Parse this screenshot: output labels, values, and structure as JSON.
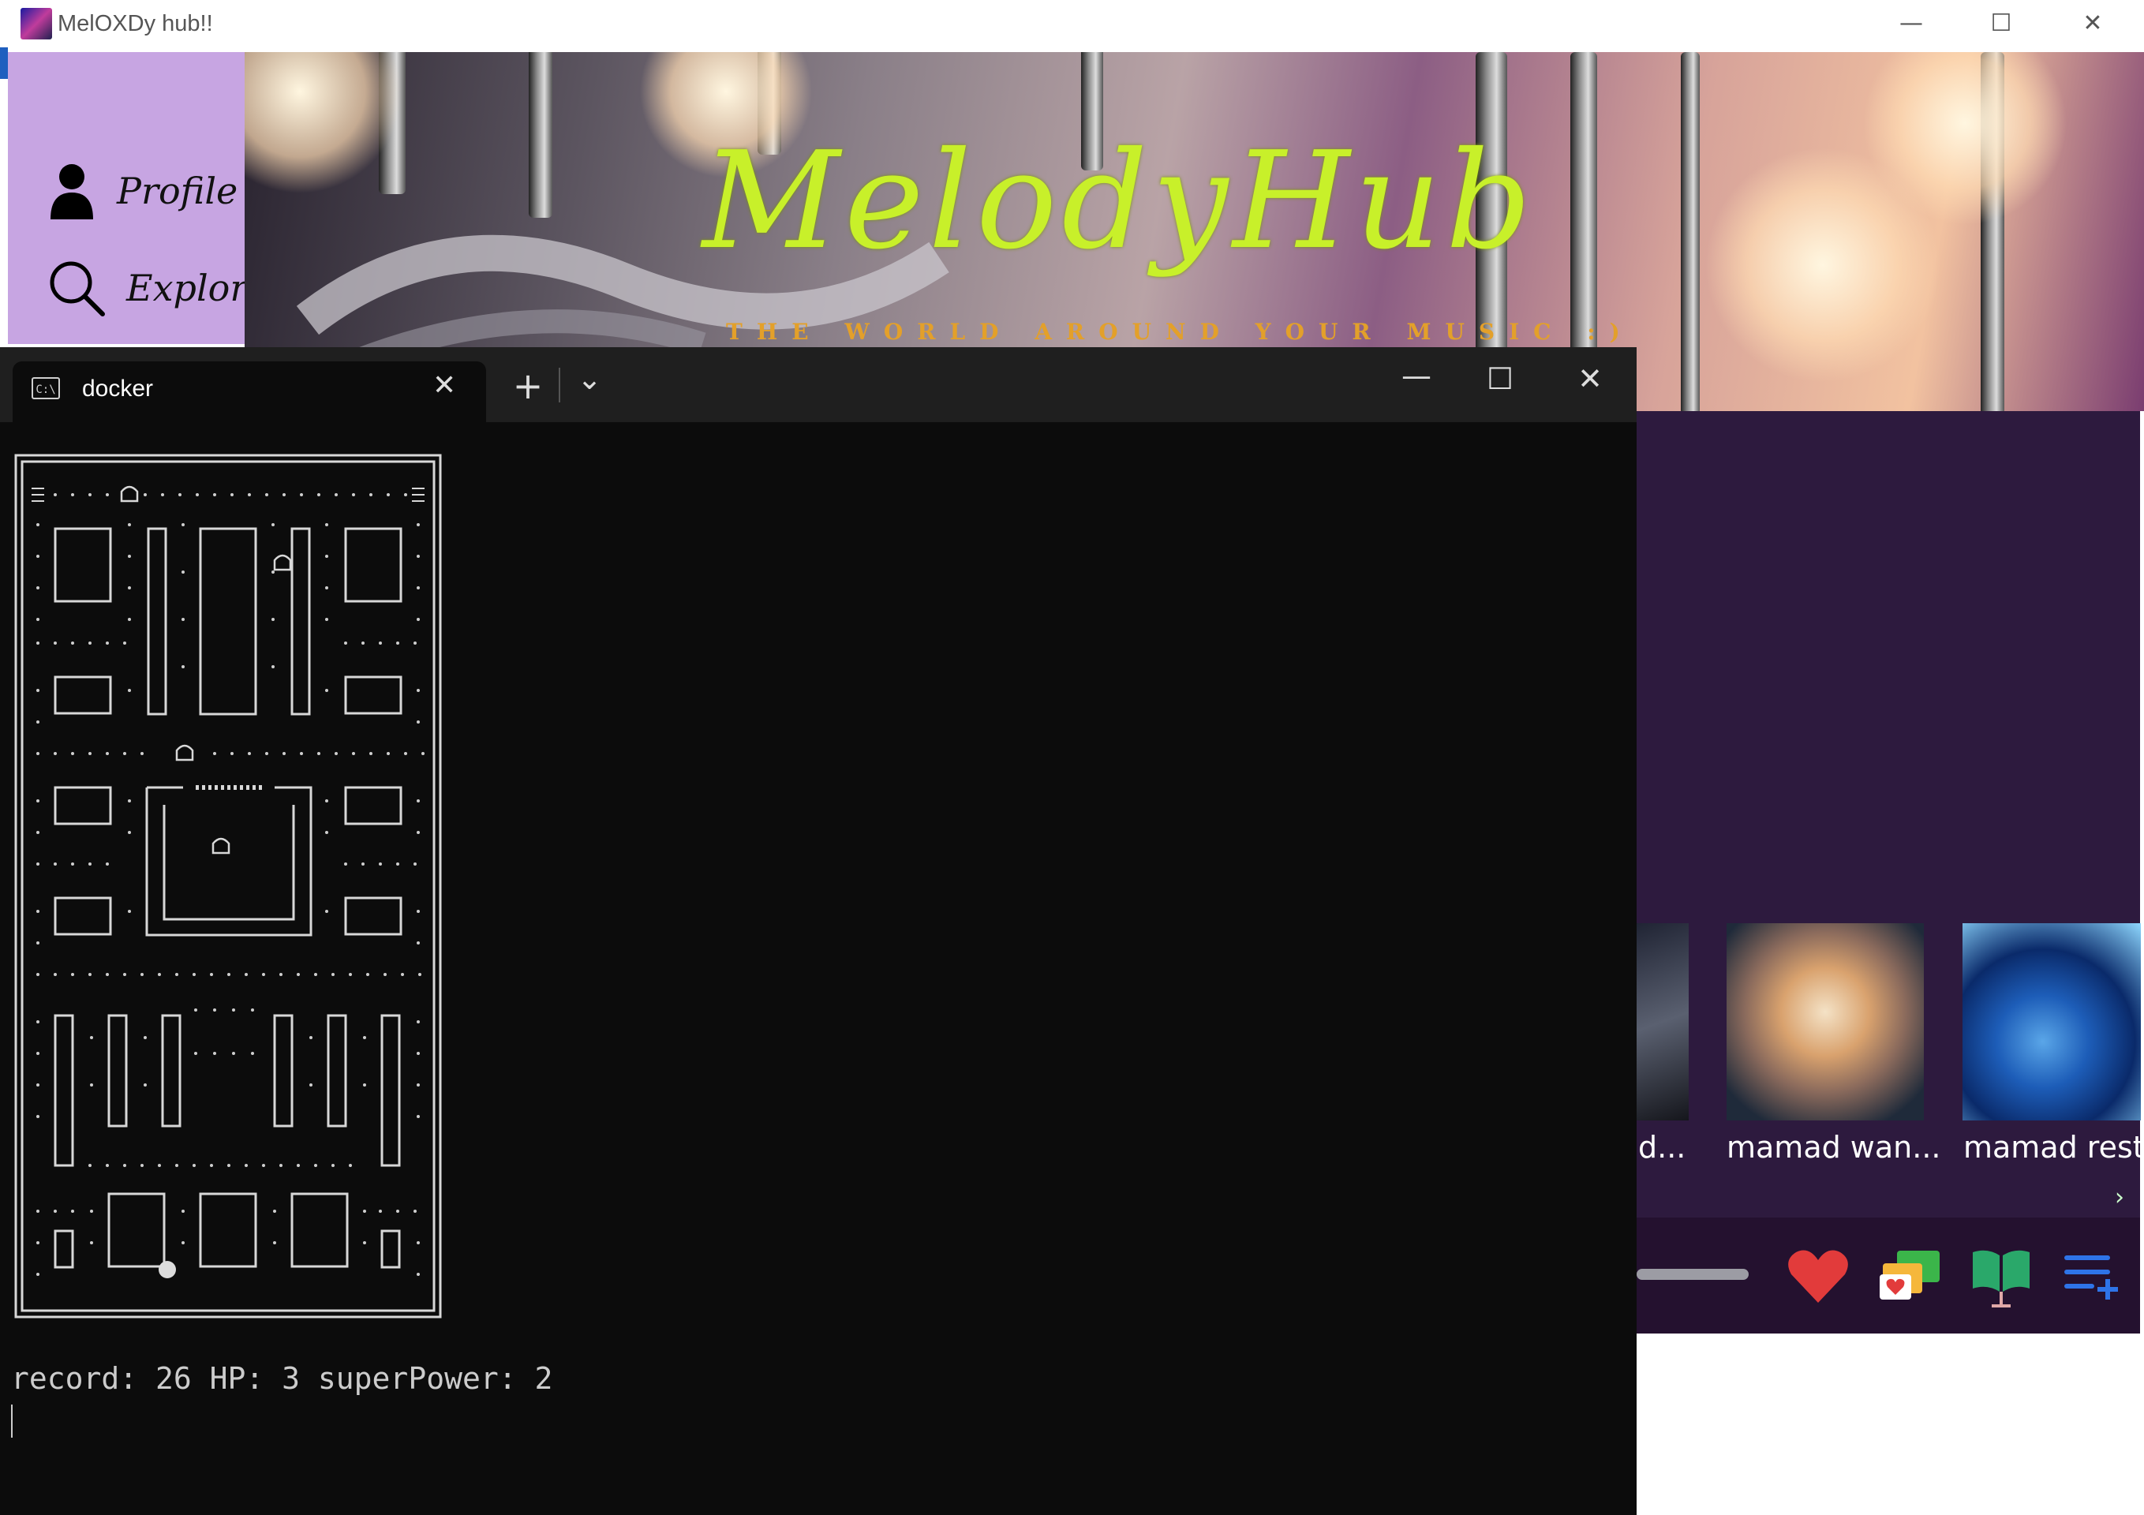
{
  "melody_app": {
    "window_title": "MelOXDy hub!!",
    "controls": {
      "minimize": "—",
      "maximize": "☐",
      "close": "✕"
    },
    "nav": [
      {
        "label": "Profile",
        "icon": "person-icon"
      },
      {
        "label": "Explore",
        "icon": "search-icon"
      }
    ],
    "banner": {
      "logo_text": "MelodyHub",
      "tagline": "THE WORLD AROUND YOUR MUSIC :)"
    },
    "cards": [
      {
        "label": "d..."
      },
      {
        "label": "mamad wan..."
      },
      {
        "label": "mamad rest."
      }
    ],
    "scroll_right": "›",
    "player_icons": [
      "heart-icon",
      "comments-icon",
      "lyrics-book-icon",
      "add-to-playlist-icon"
    ],
    "colors": {
      "sidebar": "#c7a5e2",
      "content": "#2d1a3e",
      "logo": "#c8f02a",
      "tagline": "#e3a02a"
    }
  },
  "terminal": {
    "tab_title": "docker",
    "tab_icon_text": "C:\\",
    "new_tab": "+",
    "dropdown": "⌄",
    "controls": {
      "minimize": "—",
      "maximize": "☐",
      "close": "✕"
    },
    "game": {
      "status": "record: 26 HP: 3 superPower: 2",
      "record": 26,
      "hp": 3,
      "super_power": 2
    },
    "colors": {
      "background": "#0c0c0c",
      "tabbar": "#1f1f1f",
      "text": "#cccccc"
    }
  }
}
